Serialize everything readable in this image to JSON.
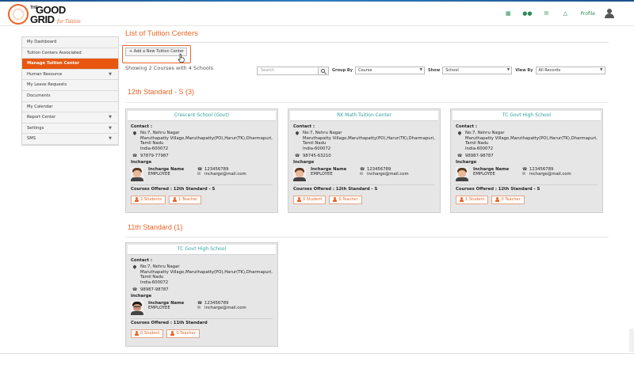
{
  "brand": {
    "the": "THE",
    "good": "GOOD",
    "grid": "GRID",
    "tagline": "for Tuition"
  },
  "header": {
    "profile_label": "Profile",
    "icons": [
      "grid-icon",
      "users-icon",
      "mail-icon",
      "bell-icon",
      "user-avatar-icon"
    ]
  },
  "sidebar": {
    "items": [
      {
        "label": "My Dashboard",
        "active": false,
        "caret": false
      },
      {
        "label": "Tuition Centers Associated",
        "active": false,
        "caret": false
      },
      {
        "label": "Manage Tuition Center",
        "active": true,
        "caret": false
      },
      {
        "label": "Human Resource",
        "active": false,
        "caret": true
      },
      {
        "label": "My Leave Requests",
        "active": false,
        "caret": false
      },
      {
        "label": "Documents",
        "active": false,
        "caret": false
      },
      {
        "label": "My Calendar",
        "active": false,
        "caret": false
      },
      {
        "label": "Report Center",
        "active": false,
        "caret": true
      },
      {
        "label": "Settings",
        "active": false,
        "caret": true
      },
      {
        "label": "SMS",
        "active": false,
        "caret": true
      }
    ]
  },
  "main": {
    "title": "List of Tuition Centers",
    "add_button": "+ Add a New Tuition Center",
    "showing": "Showing 2 Courses with 4 Schools",
    "search_placeholder": "Search",
    "group_by_label": "Group By",
    "group_by_value": "Course",
    "show_label": "Show",
    "show_value": "School",
    "view_by_label": "View By",
    "view_by_value": "All Records"
  },
  "labels": {
    "contact": "Contact :",
    "incharge": "Incharge",
    "incharge_name": "Incharge Name",
    "courses_offered": "Courses Offered :"
  },
  "sections": [
    {
      "title": "12th Standard - S (3)",
      "cards": [
        {
          "name": "Crescent School (Govt)",
          "address_lines": [
            "No:7, Nehru Nagar",
            "Maruthapatty Village,Maruthapatty(PO),Harur(TK),Dharmapuri,",
            "Tamil Nadu",
            "India-600072"
          ],
          "phone": "97879-77987",
          "incharge_role": "EMPLOYEE",
          "incharge_phone": "123456789",
          "incharge_email": "incharge@mail.com",
          "courses": "12th Standard - S",
          "students": "2 Students",
          "teachers": "1 Teacher",
          "face": "light"
        },
        {
          "name": "RK Math Tuition Center",
          "address_lines": [
            "No:7, Nehru Nagar",
            "Maruthapatty Village,Maruthapatty(PO),Harur(TK),Dharmapuri,",
            "Tamil Nadu",
            "India-600072"
          ],
          "phone": "98745-63210",
          "incharge_role": "EMPLOYEE",
          "incharge_phone": "123456789",
          "incharge_email": "incharge@mail.com",
          "courses": "12th Standard - S",
          "students": "0 Student",
          "teachers": "0 Teacher",
          "face": "light"
        },
        {
          "name": "TC Govt High School",
          "address_lines": [
            "No:7, Nehru Nagar",
            "Maruthapatty Village,Maruthapatty(PO),Harur(TK),Dharmapuri,",
            "Tamil Nadu",
            "India-600072"
          ],
          "phone": "98987-98787",
          "incharge_role": "EMPLOYEE",
          "incharge_phone": "123456789",
          "incharge_email": "incharge@mail.com",
          "courses": "12th Standard - S",
          "students": "1 Student",
          "teachers": "0 Teacher",
          "face": "light"
        }
      ]
    },
    {
      "title": "11th Standard (1)",
      "cards": [
        {
          "name": "TC Govt High School",
          "address_lines": [
            "No:7, Nehru Nagar",
            "Maruthapatty Village,Maruthapatty(PO),Harur(TK),Dharmapuri,",
            "Tamil Nadu",
            "India-600072"
          ],
          "phone": "98987-98787",
          "incharge_role": "EMPLOYEE",
          "incharge_phone": "123456789",
          "incharge_email": "incharge@mail.com",
          "courses": "11th Standard",
          "students": "0 Student",
          "teachers": "0 Teacher",
          "face": "dark"
        }
      ]
    }
  ]
}
